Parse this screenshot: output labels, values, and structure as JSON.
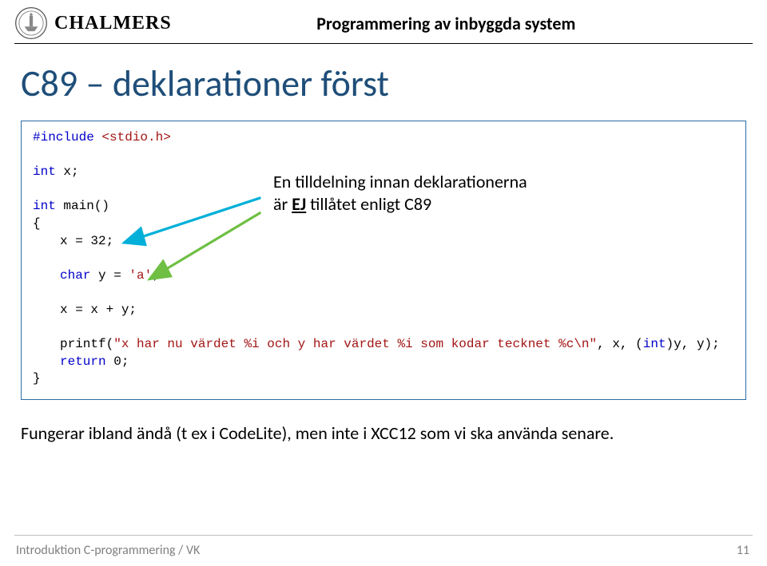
{
  "header": {
    "wordmark": "CHALMERS",
    "course_title": "Programmering av inbyggda system"
  },
  "slide": {
    "title": "C89 – deklarationer först"
  },
  "code": {
    "line1_kw": "#include ",
    "line1_path": "<stdio.h>",
    "line2a": "int",
    "line2b": " x;",
    "line3a": "int",
    "line3b": " main()",
    "lbrace": "{",
    "l4": "x = 32;",
    "l5a": "char",
    "l5b": " y = ",
    "l5c": "'a'",
    "l5d": ";",
    "l6": "x = x + y;",
    "l7a": "printf(",
    "l7b": "\"x har nu värdet %i och y har värdet %i som kodar tecknet %c\\n\"",
    "l7c": ", x, (",
    "l7d": "int",
    "l7e": ")y, y);",
    "l8a": "return",
    "l8b": " 0;",
    "rbrace": "}"
  },
  "callout": {
    "line1": "En tilldelning innan deklarationerna",
    "line2a": "är ",
    "line2b": "EJ",
    "line2c": " tillåtet enligt C89"
  },
  "body": {
    "text": "Fungerar ibland ändå (t ex i CodeLite), men inte i XCC12 som vi ska använda senare."
  },
  "footer": {
    "left": "Introduktion C-programmering / VK",
    "page": "11"
  }
}
